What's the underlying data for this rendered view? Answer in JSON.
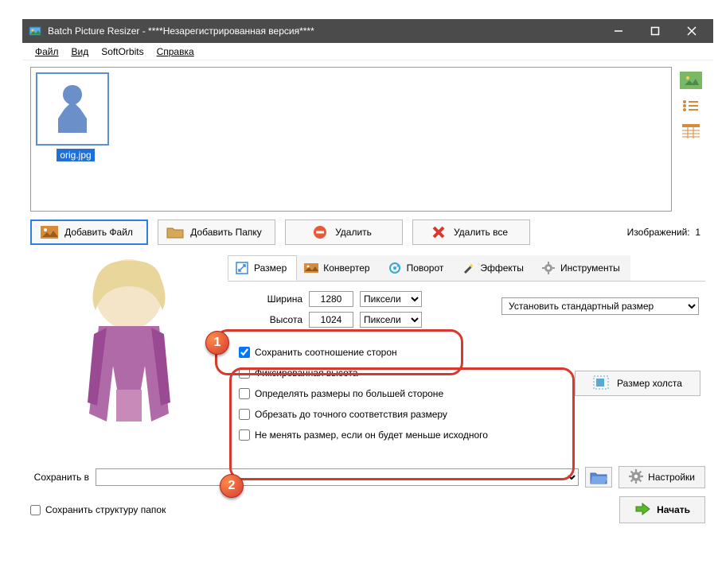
{
  "window": {
    "title": "Batch Picture Resizer - ****Незарегистрированная версия****"
  },
  "menu": {
    "file": "Файл",
    "view": "Вид",
    "softorbits": "SoftOrbits",
    "help": "Справка"
  },
  "file_list": {
    "items": [
      {
        "name": "orig.jpg"
      }
    ]
  },
  "toolbar": {
    "add_file": "Добавить Файл",
    "add_folder": "Добавить Папку",
    "delete": "Удалить",
    "delete_all": "Удалить все",
    "image_count_label": "Изображений:",
    "image_count": "1"
  },
  "tabs": {
    "size": "Размер",
    "converter": "Конвертер",
    "rotate": "Поворот",
    "effects": "Эффекты",
    "tools": "Инструменты"
  },
  "size_panel": {
    "width_label": "Ширина",
    "width_value": "1280",
    "width_unit": "Пиксели",
    "height_label": "Высота",
    "height_value": "1024",
    "height_unit": "Пиксели",
    "std_size": "Установить стандартный размер",
    "canvas_btn": "Размер холста",
    "opts": {
      "keep_ratio": "Сохранить соотношение сторон",
      "fixed_height": "Фиксированная высота",
      "by_larger_side": "Определять размеры по большей стороне",
      "crop_exact": "Обрезать до точного соответствия размеру",
      "no_upscale": "Не менять размер, если он будет меньше исходного"
    },
    "checked": {
      "keep_ratio": true,
      "fixed_height": false,
      "by_larger_side": false,
      "crop_exact": false,
      "no_upscale": false
    }
  },
  "save": {
    "label": "Сохранить в",
    "path": "",
    "settings": "Настройки"
  },
  "bottom": {
    "keep_structure": "Сохранить структуру папок",
    "start": "Начать"
  },
  "annotations": {
    "badge1": "1",
    "badge2": "2"
  }
}
